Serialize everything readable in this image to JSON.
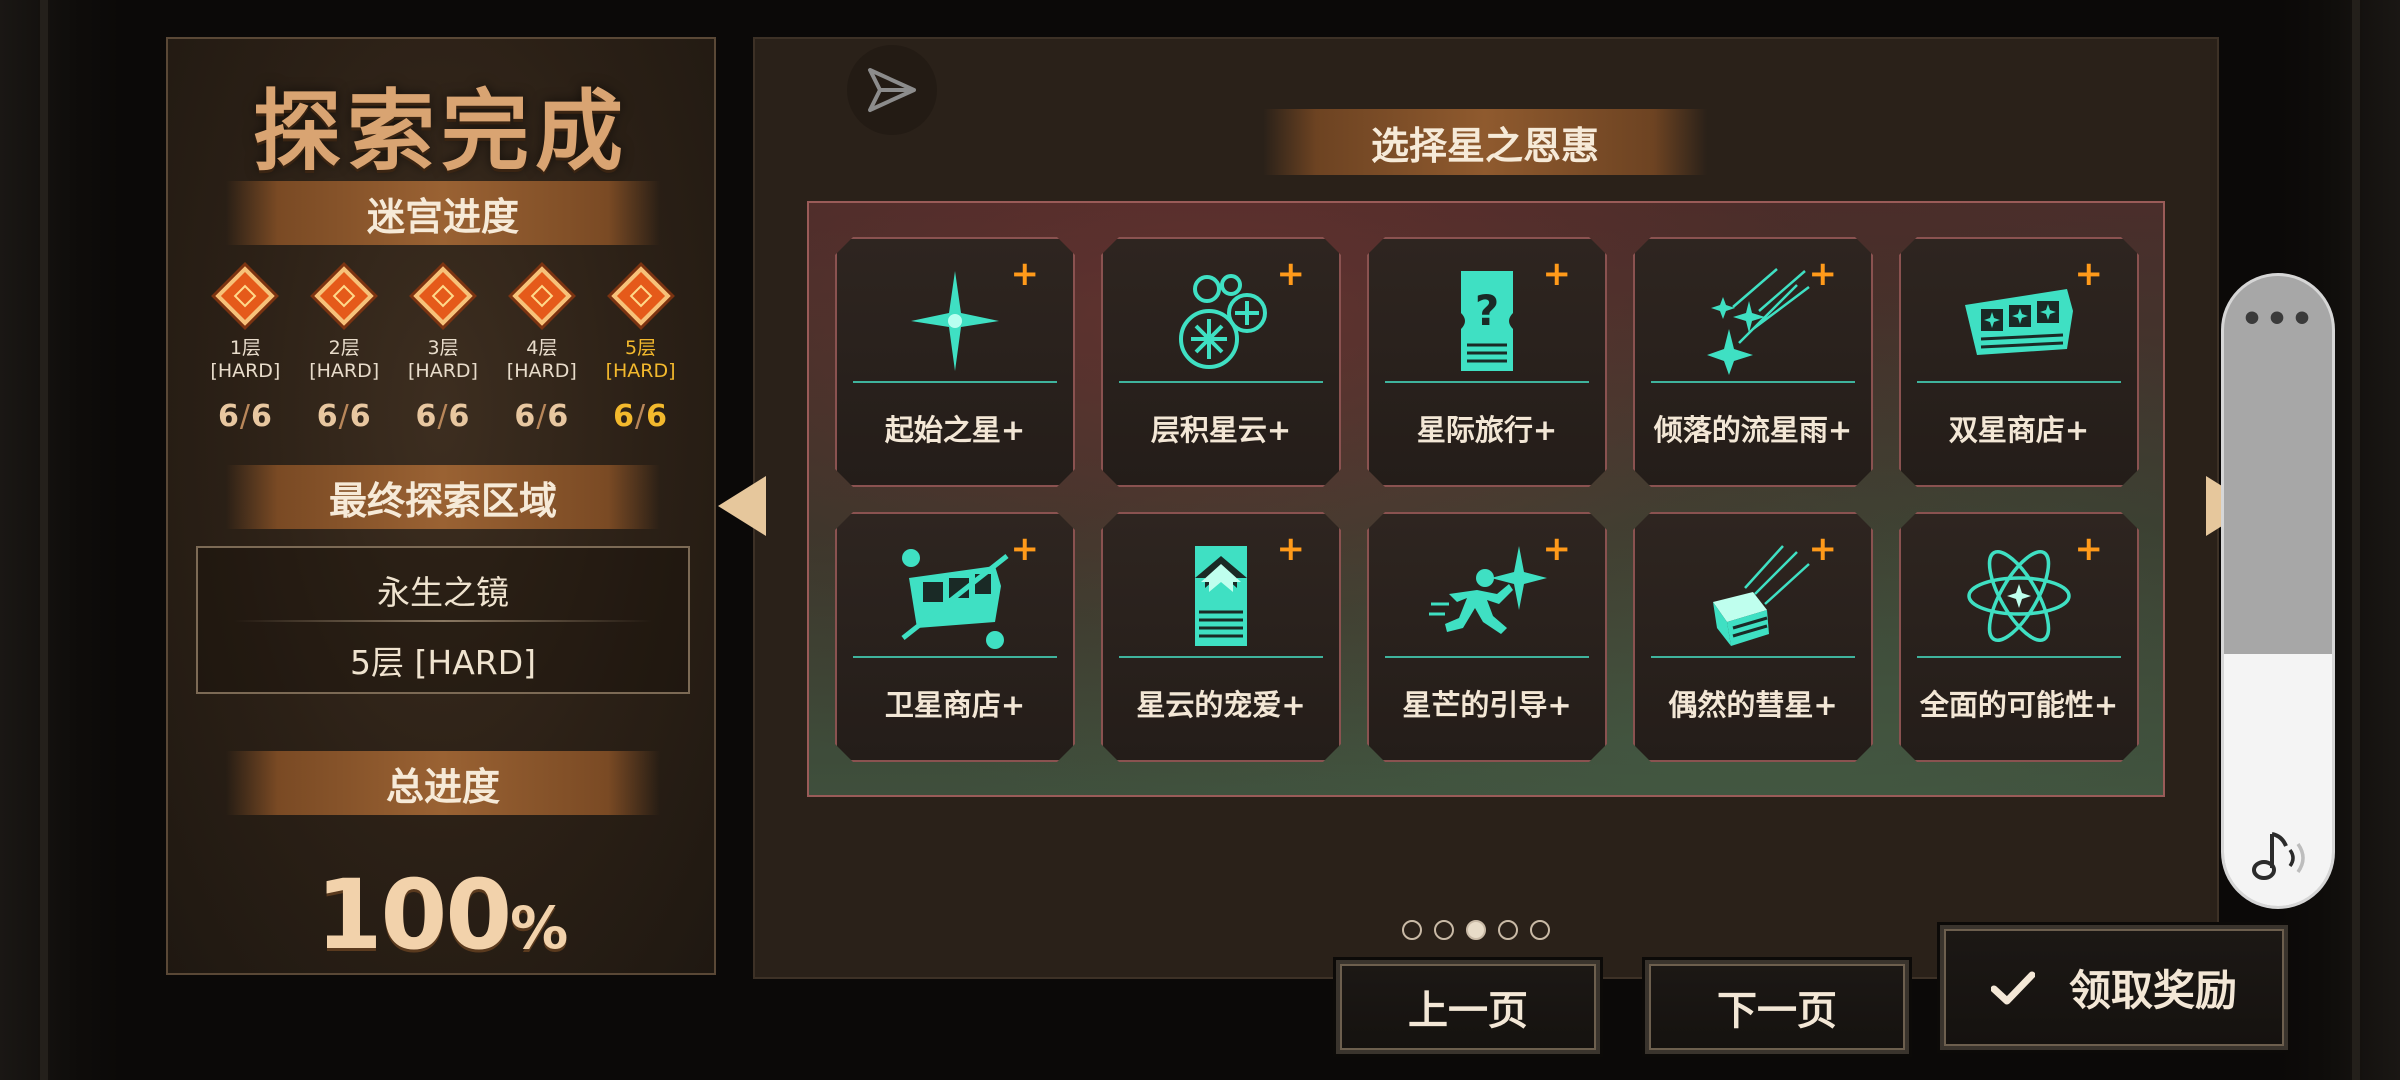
{
  "left_panel": {
    "title": "探索完成",
    "maze_progress_label": "迷宫进度",
    "floors": [
      {
        "name": "1层",
        "difficulty": "[HARD]",
        "cleared": "6",
        "total": "6",
        "current": false
      },
      {
        "name": "2层",
        "difficulty": "[HARD]",
        "cleared": "6",
        "total": "6",
        "current": false
      },
      {
        "name": "3层",
        "difficulty": "[HARD]",
        "cleared": "6",
        "total": "6",
        "current": false
      },
      {
        "name": "4层",
        "difficulty": "[HARD]",
        "cleared": "6",
        "total": "6",
        "current": false
      },
      {
        "name": "5层",
        "difficulty": "[HARD]",
        "cleared": "6",
        "total": "6",
        "current": true
      }
    ],
    "final_area_label": "最终探索区域",
    "final_area_name": "永生之镜",
    "final_area_floor": "5层 [HARD]",
    "total_progress_label": "总进度",
    "total_progress_value": "100",
    "total_progress_unit": "%"
  },
  "right_panel": {
    "title": "选择星之恩惠",
    "blessings": [
      {
        "label": "起始之星+",
        "icon": "sparkle-star-icon"
      },
      {
        "label": "层积星云+",
        "icon": "nebula-cluster-icon"
      },
      {
        "label": "星际旅行+",
        "icon": "mystery-ticket-icon"
      },
      {
        "label": "倾落的流星雨+",
        "icon": "meteor-shower-icon"
      },
      {
        "label": "双星商店+",
        "icon": "star-shop-icon"
      },
      {
        "label": "卫星商店+",
        "icon": "satellite-shop-icon"
      },
      {
        "label": "星云的宠爱+",
        "icon": "nebula-upgrade-icon"
      },
      {
        "label": "星芒的引导+",
        "icon": "running-star-icon"
      },
      {
        "label": "偶然的彗星+",
        "icon": "comet-box-icon"
      },
      {
        "label": "全面的可能性+",
        "icon": "atom-orbit-icon"
      }
    ],
    "plus_glyph": "+",
    "page_current": 3,
    "page_total": 5
  },
  "buttons": {
    "prev": "上一页",
    "next": "下一页",
    "claim": "领取奖励"
  },
  "float_pill": {
    "more": "•••",
    "level": 0.4
  },
  "colors": {
    "accent_teal": "#3fe0c3",
    "plus_orange": "#ff9a1a",
    "ribbon_brown": "#9a6233",
    "title_tan": "#d9a472",
    "current_gold": "#f3b92d"
  }
}
